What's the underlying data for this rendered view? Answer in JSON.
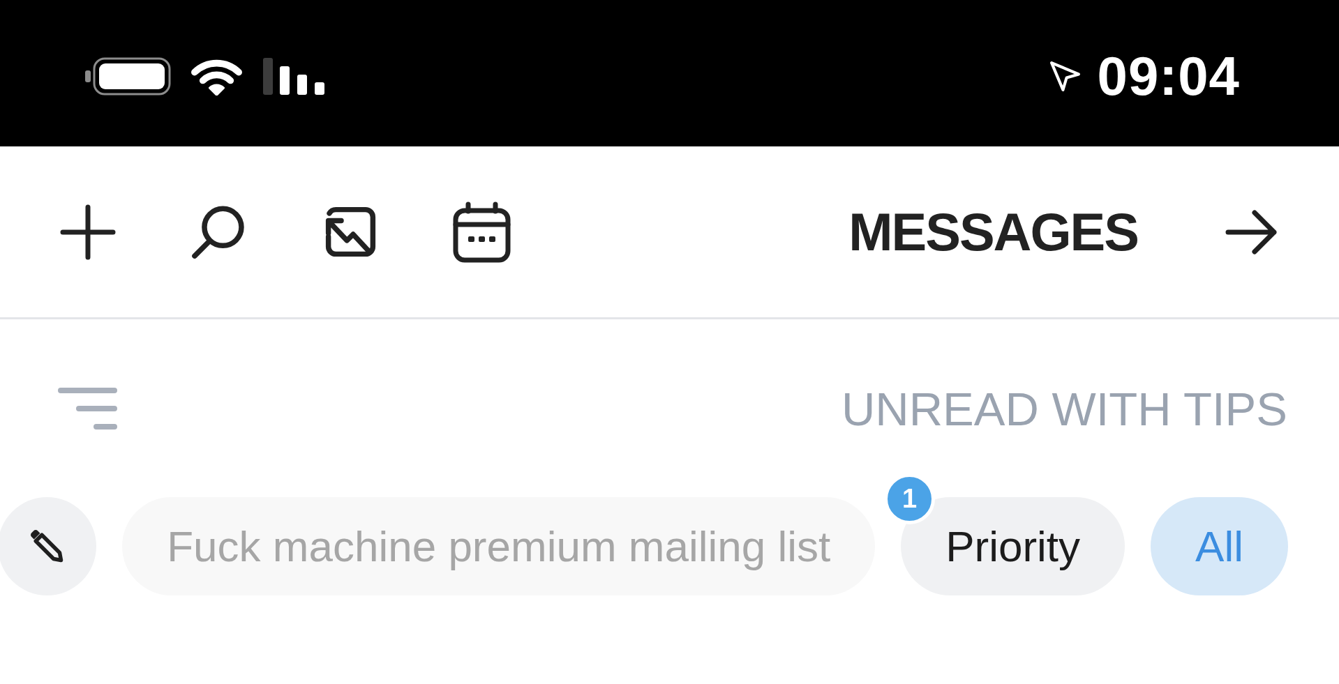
{
  "status_bar": {
    "time": "09:04"
  },
  "header": {
    "title": "MESSAGES"
  },
  "section": {
    "title": "UNREAD WITH TIPS"
  },
  "filters": [
    {
      "label": "Fuck machine premium mailing list",
      "selected": false,
      "disabled": true
    },
    {
      "label": "Priority",
      "selected": false,
      "disabled": false,
      "badge": "1"
    },
    {
      "label": "All",
      "selected": true,
      "disabled": false
    }
  ]
}
